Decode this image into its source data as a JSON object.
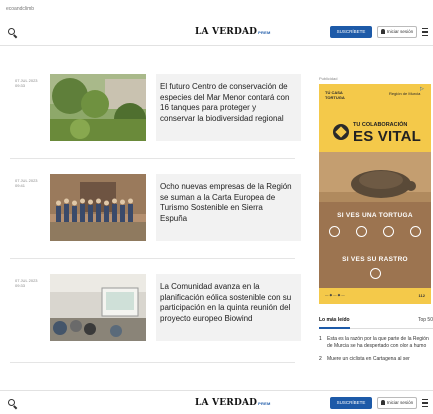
{
  "breadcrumb": "ecoandclimb",
  "header": {
    "logo_text": "LA VERDAD",
    "logo_sub": "PREM",
    "subscribe_label": "SUSCRÍBETE",
    "login_label": "Iniciar sesión"
  },
  "articles": [
    {
      "date": "07 JUL 2023 09:33",
      "headline": "El futuro Centro de conservación de especies del Mar Menor contará con 16 tanques para proteger y conservar la biodiversidad regional"
    },
    {
      "date": "07 JUL 2023 09:41",
      "headline": "Ocho nuevas empresas de la Región se suman a la Carta Europea de Turismo Sostenible en Sierra Espuña"
    },
    {
      "date": "07 JUL 2023 09:33",
      "headline": "La Comunidad avanza en la planificación eólica sostenible con su participación en la quinta reunión del proyecto europeo Biowind"
    }
  ],
  "sidebar": {
    "ad_label": "Publicidad",
    "ad": {
      "brand_left": "TÚ CASA TORTUGA",
      "brand_right": "Región de Murcia",
      "tagline": "TU COLABORACIÓN",
      "headline": "ES VITAL",
      "line1": "SI VES UNA TORTUGA",
      "line2": "SI VES SU RASTRO",
      "footer_right": "112"
    },
    "tabs": {
      "left": "Lo más leído",
      "right": "Top 50"
    },
    "popular": [
      {
        "num": "1",
        "text": "Esta es la razón por la que parte de la Región de Murcia se ha despertado con olor a humo"
      },
      {
        "num": "2",
        "text": "Muere un ciclista en Cartagena al ser"
      }
    ]
  }
}
